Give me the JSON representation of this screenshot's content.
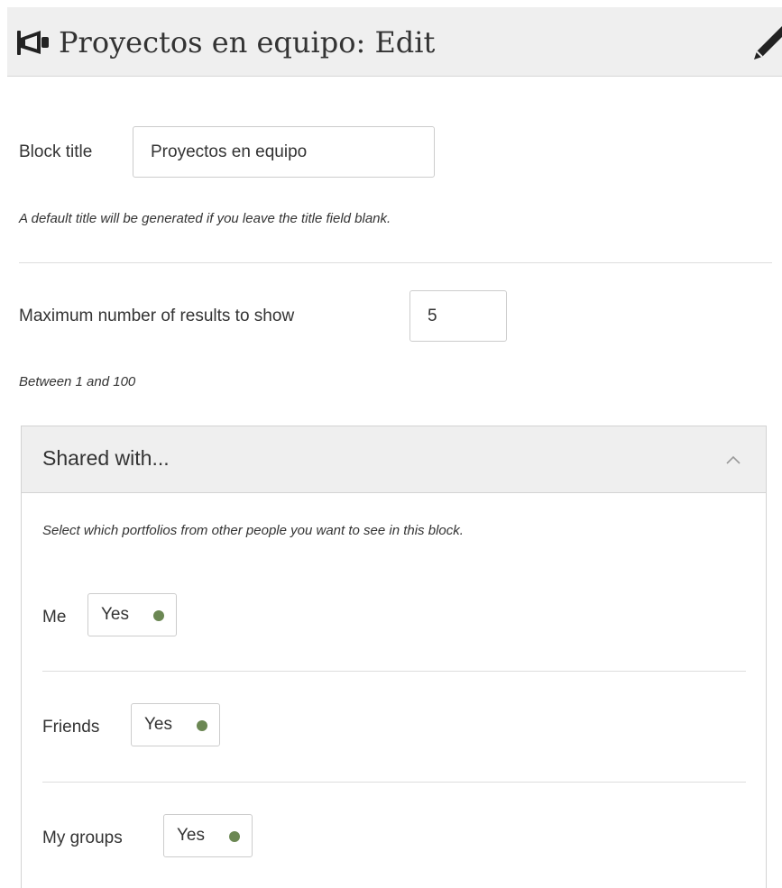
{
  "header": {
    "title": "Proyectos en equipo: Edit",
    "icon": "megaphone-icon",
    "edit_icon": "pencil-icon"
  },
  "block_title": {
    "label": "Block title",
    "value": "Proyectos en equipo",
    "hint": "A default title will be generated if you leave the title field blank."
  },
  "max_results": {
    "label": "Maximum number of results to show",
    "value": "5",
    "hint": "Between 1 and 100"
  },
  "shared_with": {
    "title": "Shared with...",
    "expanded": true,
    "description": "Select which portfolios from other people you want to see in this block.",
    "options": [
      {
        "label": "Me",
        "switch_label": "Yes",
        "state": "on"
      },
      {
        "label": "Friends",
        "switch_label": "Yes",
        "state": "on"
      },
      {
        "label": "My groups",
        "switch_label": "Yes",
        "state": "on"
      }
    ]
  },
  "colors": {
    "header_bg": "#efefef",
    "switch_on": "#6b8753",
    "border": "#cccccc"
  }
}
